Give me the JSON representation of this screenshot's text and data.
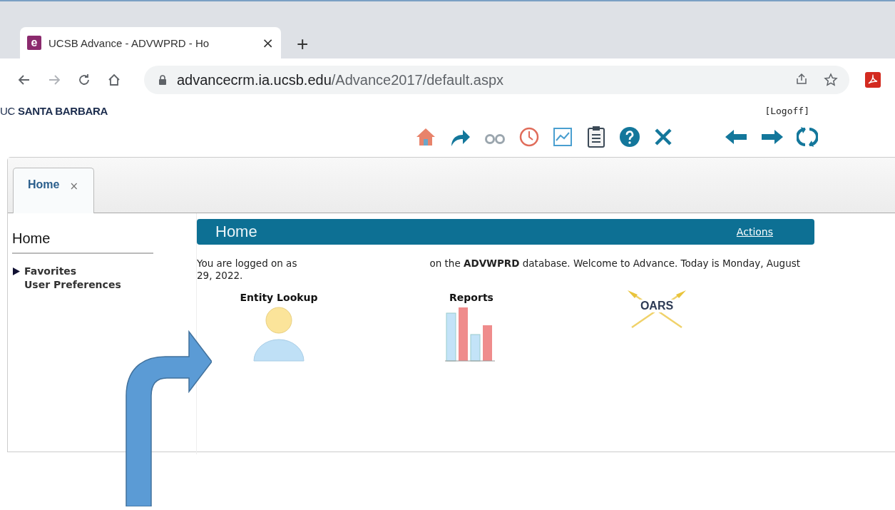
{
  "browser": {
    "tab": {
      "icon_text": "e",
      "title": "UCSB Advance - ADVWPRD - Ho",
      "close": "×"
    },
    "new_tab": "+",
    "url_host": "advancecrm.ia.ucsb.edu",
    "url_path": "/Advance2017/default.aspx"
  },
  "header": {
    "logo": "UC **SANTA BARBARA**",
    "logoff": "[Logoff]"
  },
  "tabs": [
    {
      "label": "Home",
      "close": "×",
      "selected": true
    }
  ],
  "sidebar": {
    "title": "Home",
    "items": [
      {
        "label": "Favorites",
        "expanded": false
      },
      {
        "label": "User Preferences"
      }
    ]
  },
  "panel": {
    "title": "Home",
    "action": "Actions",
    "welcome_start": "You are logged on as",
    "welcome_rest": "on the **ADVWPRD** database. Welcome to Advance. Today is Monday, August 29, 2022.",
    "tiles": [
      {
        "label": "Entity Lookup",
        "kind": "person"
      },
      {
        "label": "Reports",
        "kind": "chart"
      },
      {
        "label": "OARS",
        "kind": "oars"
      }
    ]
  }
}
